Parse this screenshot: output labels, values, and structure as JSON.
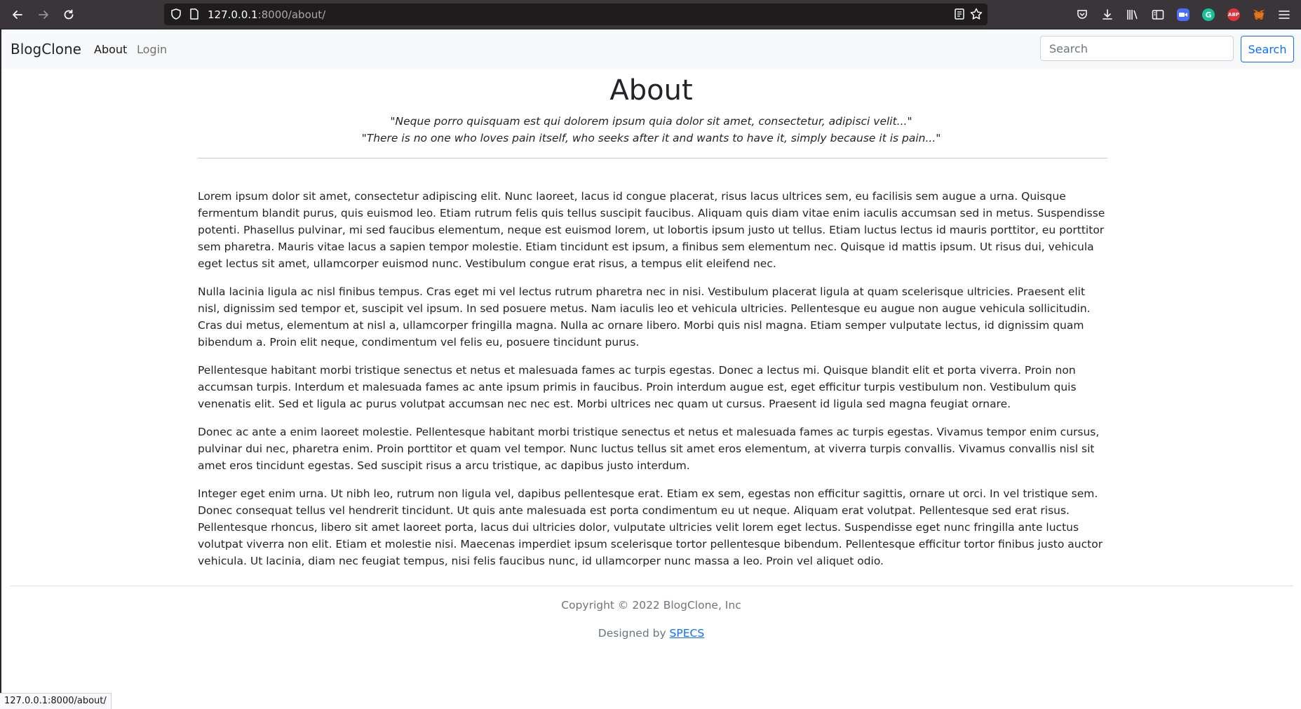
{
  "browser": {
    "url_host": "127.0.0.1",
    "url_path": ":8000/about/",
    "status_url": "127.0.0.1:8000/about/",
    "extensions": [
      {
        "name": "pocket-icon"
      },
      {
        "name": "downloads-icon"
      },
      {
        "name": "library-icon"
      },
      {
        "name": "sidebar-icon"
      },
      {
        "name": "zoom-extension-icon",
        "color": "#4a6cf7"
      },
      {
        "name": "grammarly-extension-icon",
        "label": "G",
        "color": "#15c39a"
      },
      {
        "name": "adblock-extension-icon",
        "label": "ABP",
        "color": "#e0323a"
      },
      {
        "name": "metamask-extension-icon",
        "color": "#e2761b"
      },
      {
        "name": "menu-icon"
      }
    ]
  },
  "navbar": {
    "brand": "BlogClone",
    "links": [
      {
        "label": "About",
        "active": true
      },
      {
        "label": "Login",
        "active": false
      }
    ],
    "search_placeholder": "Search",
    "search_button": "Search"
  },
  "page": {
    "title": "About",
    "quote_1": "\"Neque porro quisquam est qui dolorem ipsum quia dolor sit amet, consectetur, adipisci velit...\"",
    "quote_2": "\"There is no one who loves pain itself, who seeks after it and wants to have it, simply because it is pain...\"",
    "paragraphs": [
      "Lorem ipsum dolor sit amet, consectetur adipiscing elit. Nunc laoreet, lacus id congue placerat, risus lacus ultrices sem, eu facilisis sem augue a urna. Quisque fermentum blandit purus, quis euismod leo. Etiam rutrum felis quis tellus suscipit faucibus. Aliquam quis diam vitae enim iaculis accumsan sed in metus. Suspendisse potenti. Phasellus pulvinar, mi sed faucibus elementum, neque est euismod lorem, ut lobortis ipsum justo ut tellus. Etiam luctus lectus id mauris porttitor, eu porttitor sem pharetra. Mauris vitae lacus a sapien tempor molestie. Etiam tincidunt est ipsum, a finibus sem elementum nec. Quisque id mattis ipsum. Ut risus dui, vehicula eget lectus sit amet, ullamcorper euismod nunc. Vestibulum congue erat risus, a tempus elit eleifend nec.",
      "Nulla lacinia ligula ac nisl finibus tempus. Cras eget mi vel lectus rutrum pharetra nec in nisi. Vestibulum placerat ligula at quam scelerisque ultricies. Praesent elit nisl, dignissim sed tempor et, suscipit vel ipsum. In sed posuere metus. Nam iaculis leo et vehicula ultricies. Pellentesque eu augue non augue vehicula sollicitudin. Cras dui metus, elementum at nisl a, ullamcorper fringilla magna. Nulla ac ornare libero. Morbi quis nisl magna. Etiam semper vulputate lectus, id dignissim quam bibendum a. Proin elit neque, condimentum vel felis eu, posuere tincidunt purus.",
      "Pellentesque habitant morbi tristique senectus et netus et malesuada fames ac turpis egestas. Donec a lectus mi. Quisque blandit elit et porta viverra. Proin non accumsan turpis. Interdum et malesuada fames ac ante ipsum primis in faucibus. Proin interdum augue est, eget efficitur turpis vestibulum non. Vestibulum quis venenatis elit. Sed et ligula ac purus volutpat accumsan nec nec est. Morbi ultrices nec quam ut cursus. Praesent id ligula sed magna feugiat ornare.",
      "Donec ac ante a enim laoreet molestie. Pellentesque habitant morbi tristique senectus et netus et malesuada fames ac turpis egestas. Vivamus tempor enim cursus, pulvinar dui nec, pharetra enim. Proin porttitor et quam vel tempor. Nunc luctus tellus sit amet eros elementum, at viverra turpis convallis. Vivamus convallis nisl sit amet eros tincidunt egestas. Sed suscipit risus a arcu tristique, ac dapibus justo interdum.",
      "Integer eget enim urna. Ut nibh leo, rutrum non ligula vel, dapibus pellentesque erat. Etiam ex sem, egestas non efficitur sagittis, ornare ut orci. In vel tristique sem. Donec consequat tellus vel hendrerit tincidunt. Ut quis ante malesuada est porta condimentum eu ut neque. Aliquam erat volutpat. Pellentesque sed erat risus. Pellentesque rhoncus, libero sit amet laoreet porta, lacus dui ultricies dolor, vulputate ultricies velit lorem eget lectus. Suspendisse eget nunc fringilla ante luctus volutpat viverra non elit. Etiam et molestie nisi. Maecenas imperdiet ipsum scelerisque tortor pellentesque bibendum. Pellentesque efficitur tortor finibus justo auctor vehicula. Ut lacinia, diam nec feugiat tempus, nisi felis faucibus nunc, id ullamcorper nunc massa a leo. Proin vel aliquet odio."
    ]
  },
  "footer": {
    "copyright": "Copyright © 2022 BlogClone, Inc",
    "designed_by": "Designed by ",
    "designer_link": "SPECS"
  },
  "colors": {
    "accent": "#0d6efd",
    "navbar_bg": "#f8f9fa",
    "browser_bg": "#3a3538"
  }
}
